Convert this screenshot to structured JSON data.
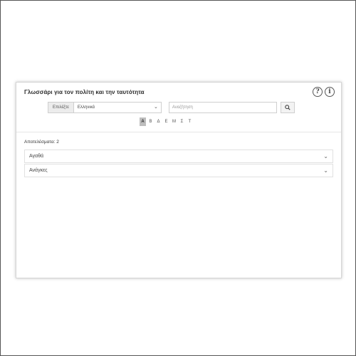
{
  "panel": {
    "title": "Γλωσσάρι για τον πολίτη και την ταυτότητα",
    "help_icons": [
      "?",
      "i"
    ]
  },
  "language_select": {
    "label": "Επιλέξτε",
    "value": "Ελληνικά"
  },
  "search": {
    "placeholder": "Αναζήτηση"
  },
  "letters": [
    {
      "label": "Α",
      "active": true
    },
    {
      "label": "Β",
      "active": false
    },
    {
      "label": "Δ",
      "active": false
    },
    {
      "label": "Ε",
      "active": false
    },
    {
      "label": "Μ",
      "active": false
    },
    {
      "label": "Σ",
      "active": false
    },
    {
      "label": "Τ",
      "active": false
    }
  ],
  "results": {
    "label": "Αποτελέσματα: 2"
  },
  "items": [
    {
      "label": "Αγαθά"
    },
    {
      "label": "Ανάγκες"
    }
  ],
  "icons": {
    "search": "magnifier-icon",
    "chevron": "chevron-down-icon"
  }
}
